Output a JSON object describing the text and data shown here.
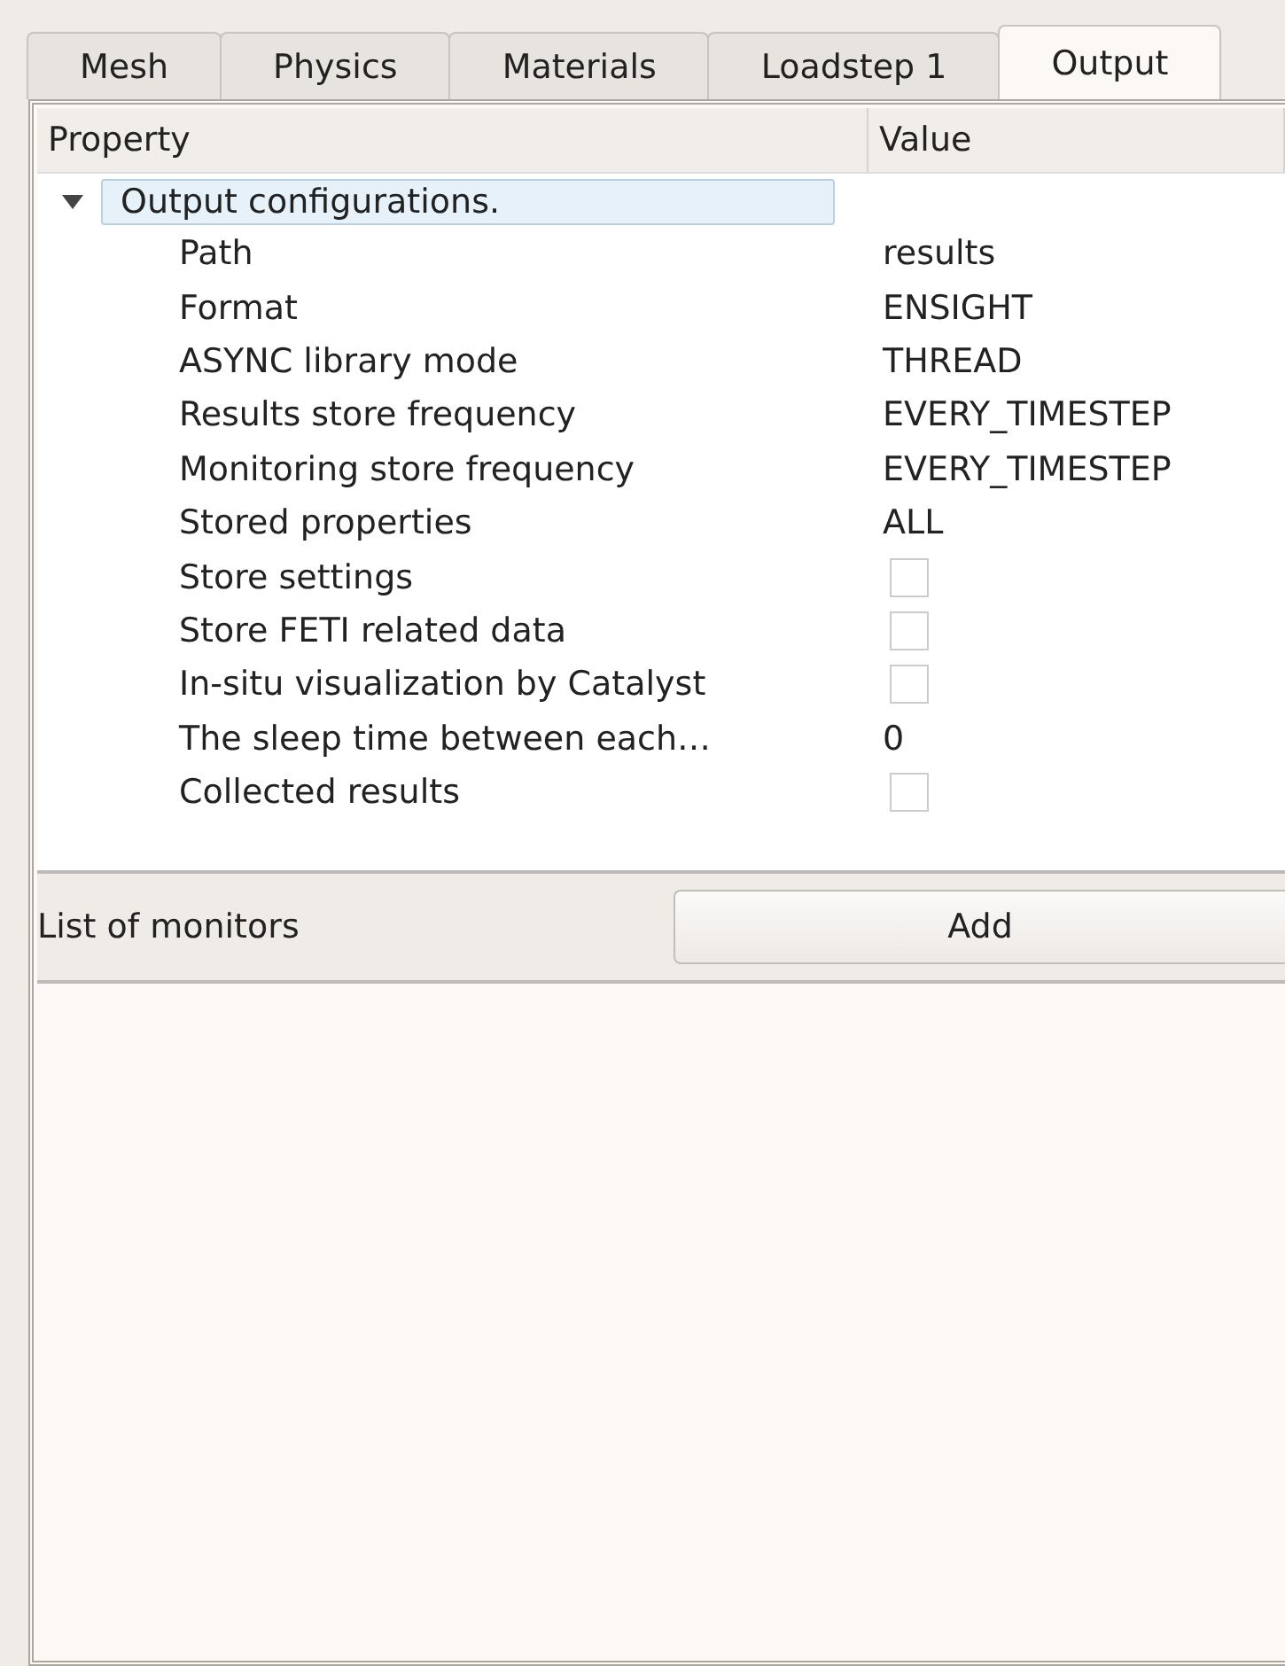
{
  "tabs": [
    {
      "label": "Mesh",
      "selected": false
    },
    {
      "label": "Physics",
      "selected": false
    },
    {
      "label": "Materials",
      "selected": false
    },
    {
      "label": "Loadstep 1",
      "selected": false
    },
    {
      "label": "Output",
      "selected": true
    }
  ],
  "table": {
    "columns": [
      "Property",
      "Value"
    ],
    "group": {
      "label": "Output configurations.",
      "expanded": true,
      "selected": true
    },
    "rows": [
      {
        "property": "Path",
        "kind": "text",
        "value": "results"
      },
      {
        "property": "Format",
        "kind": "text",
        "value": "ENSIGHT"
      },
      {
        "property": "ASYNC library mode",
        "kind": "text",
        "value": "THREAD"
      },
      {
        "property": "Results store frequency",
        "kind": "text",
        "value": "EVERY_TIMESTEP"
      },
      {
        "property": "Monitoring store frequency",
        "kind": "text",
        "value": "EVERY_TIMESTEP"
      },
      {
        "property": "Stored properties",
        "kind": "text",
        "value": "ALL"
      },
      {
        "property": "Store settings",
        "kind": "checkbox",
        "checked": false
      },
      {
        "property": "Store FETI related data",
        "kind": "checkbox",
        "checked": false
      },
      {
        "property": "In-situ visualization by Catalyst",
        "kind": "checkbox",
        "checked": false
      },
      {
        "property": "The sleep time between each…",
        "kind": "text",
        "value": "0"
      },
      {
        "property": "Collected results",
        "kind": "checkbox",
        "checked": false
      }
    ]
  },
  "monitors": {
    "label": "List of monitors",
    "button": "Add"
  }
}
